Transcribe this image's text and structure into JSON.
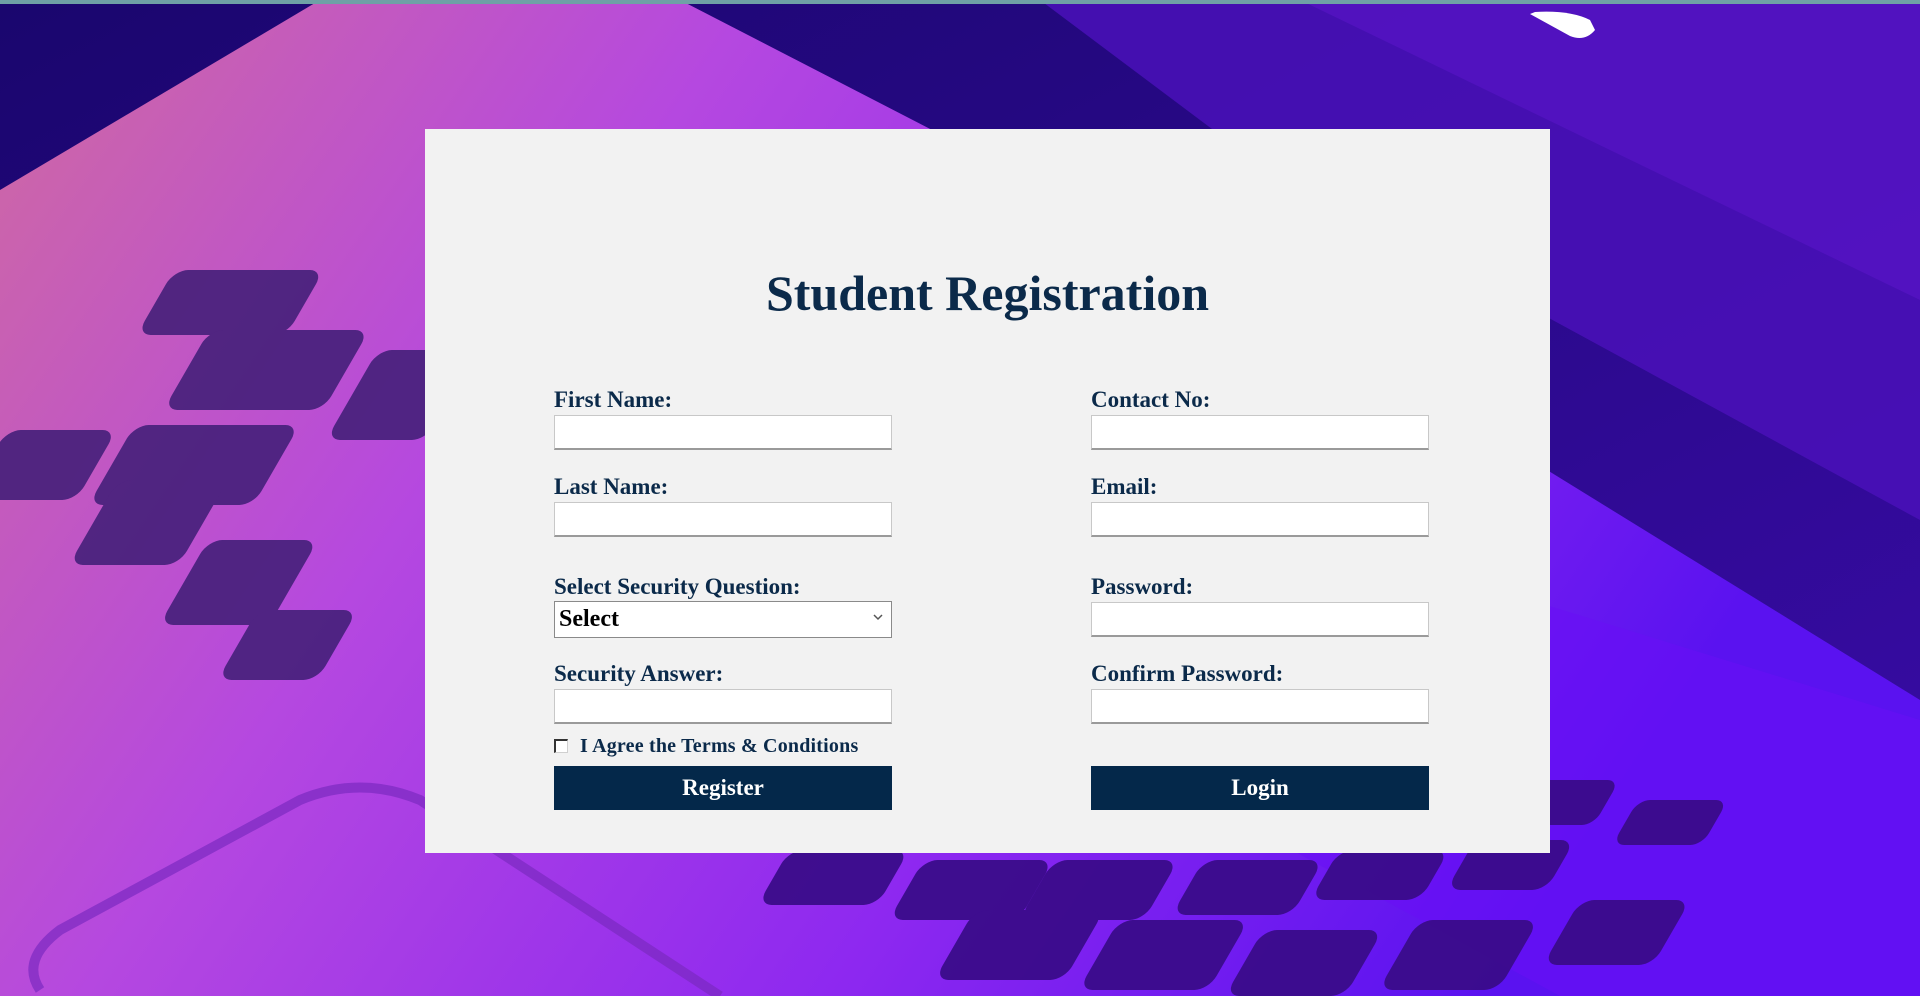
{
  "page": {
    "title": "Student Registration"
  },
  "form": {
    "first_name": {
      "label": "First Name:",
      "value": "",
      "placeholder": ""
    },
    "last_name": {
      "label": "Last Name:",
      "value": "",
      "placeholder": ""
    },
    "security_question": {
      "label": "Select Security Question:",
      "selected": "Select"
    },
    "security_answer": {
      "label": "Security Answer:",
      "value": "",
      "placeholder": ""
    },
    "contact_no": {
      "label": "Contact No:",
      "value": "",
      "placeholder": ""
    },
    "email": {
      "label": "Email:",
      "value": "",
      "placeholder": ""
    },
    "password": {
      "label": "Password:",
      "value": "",
      "placeholder": ""
    },
    "confirm_password": {
      "label": "Confirm Password:",
      "value": "",
      "placeholder": ""
    },
    "terms": {
      "label": "I Agree the Terms & Conditions",
      "checked": false
    }
  },
  "buttons": {
    "register": "Register",
    "login": "Login"
  },
  "colors": {
    "primary": "#04284a",
    "card_background": "#f2f2f2",
    "background_purple": "#2a0b8f",
    "background_magenta": "#b13fe6"
  },
  "icons": {
    "select_chevron": "chevron-down-icon",
    "checkbox": "checkbox-icon"
  }
}
